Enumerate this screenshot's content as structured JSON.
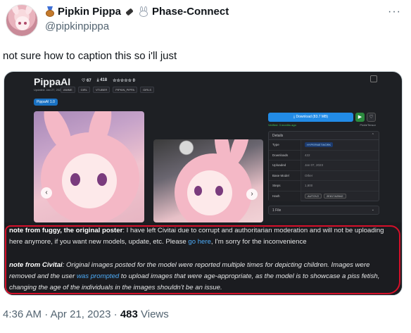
{
  "tweet": {
    "display_name": "Pipkin Pippa",
    "name_suffix": "Phase-Connect",
    "handle": "@pipkinpippa",
    "text": "not sure how to caption this so i'll just",
    "time": "4:36 AM",
    "date": "Apr 21, 2023",
    "views_count": "483",
    "views_label": "Views",
    "separator": "·",
    "more": "···"
  },
  "screenshot": {
    "title": "PippaAI",
    "stats": [
      "67",
      "418",
      "0"
    ],
    "updated": "Updated: Jan 27, 2023",
    "tags": [
      "ANIME",
      "GIRL",
      "VTUBER",
      "PIPKIN_PIPPA",
      "GIRLS"
    ],
    "version": "PippaAI 1.0",
    "download": "Download (83.7 MB)",
    "verified": "Verified: 3 months ago",
    "format": "PickleTensor",
    "details_title": "Details",
    "details": [
      {
        "key": "Type",
        "value": "HYPERNETWORK",
        "pill": true
      },
      {
        "key": "Downloads",
        "value": "422"
      },
      {
        "key": "Uploaded",
        "value": "Jan 07, 2023"
      },
      {
        "key": "Base Model",
        "value": "Other"
      },
      {
        "key": "Steps",
        "value": "1,800"
      },
      {
        "key": "Hash",
        "value": "AUTOV2",
        "value2": "2E817A2B42"
      }
    ],
    "files": "1 File"
  },
  "notes": {
    "n1_label": "note from fuggy, the original poster",
    "n1_text_a": ": I have left Civitai due to corrupt and authoritarian moderation and will not be uploading here anymore, if you want new models, update, etc. Please ",
    "n1_link": "go here",
    "n1_text_b": ", I'm sorry for the inconvenience",
    "n2_label": "note from Civitai",
    "n2_text_a": ": Original images posted for the model were reported multiple times for depicting children. Images were removed and the user ",
    "n2_link": "was prompted",
    "n2_text_b": " to upload images that were age-appropriate, as the model is to showcase a piss fetish, changing the age of the individuals in the images shouldn't be an issue."
  },
  "colors": {
    "link": "#4dabf7",
    "highlight_border": "#d5102a",
    "download": "#228be6",
    "secondary_text": "#536471"
  }
}
